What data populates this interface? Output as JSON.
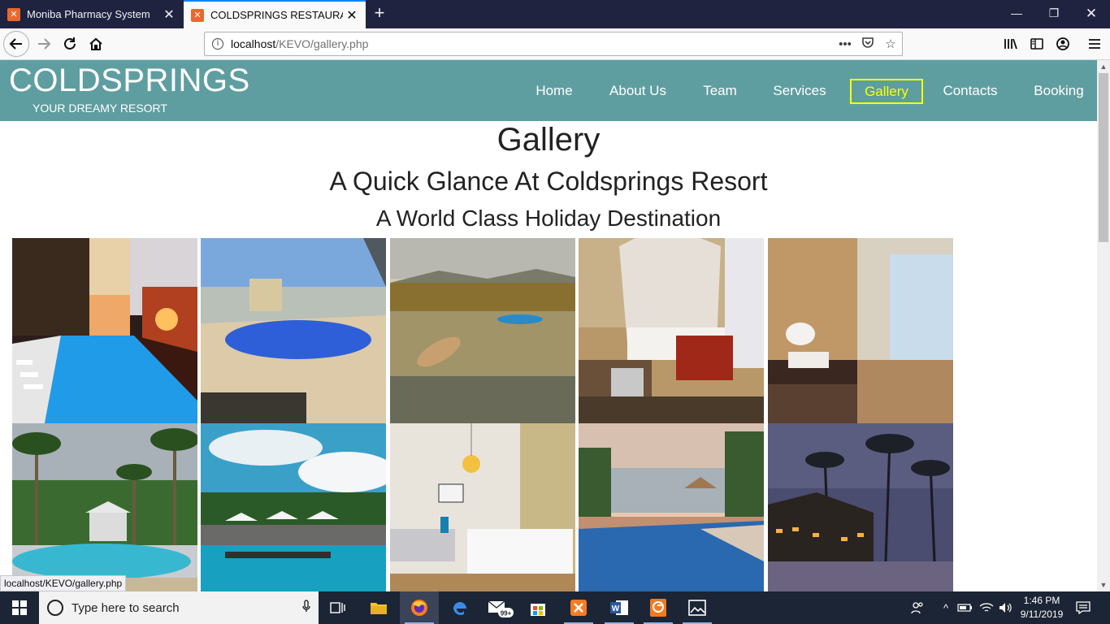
{
  "browser": {
    "tabs": [
      {
        "label": "Moniba Pharmacy System",
        "active": false
      },
      {
        "label": "COLDSPRINGS RESTAURANT",
        "active": true
      }
    ],
    "url_host": "localhost",
    "url_path": "/KEVO/gallery.php",
    "status_url": "localhost/KEVO/gallery.php"
  },
  "site": {
    "brand": "COLDSPRINGS",
    "tagline": "YOUR DREAMY RESORT",
    "menu": [
      "Home",
      "About Us",
      "Team",
      "Services",
      "Gallery",
      "Contacts",
      "Booking"
    ],
    "active_menu": "Gallery",
    "header_color": "#5f9ea0",
    "active_color": "#ffff00"
  },
  "content": {
    "heading": "Gallery",
    "subheading": "A Quick Glance At Coldsprings Resort",
    "tagline2": "A World Class Holiday Destination",
    "photos": [
      {
        "subject": "city hotel infinity pool at dusk"
      },
      {
        "subject": "rooftop swimming pool with loungers"
      },
      {
        "subject": "rowing boats on calm lake with reeds"
      },
      {
        "subject": "canopy bed hotel room"
      },
      {
        "subject": "hotel bathroom with glass shower"
      },
      {
        "subject": "tropical pool with palm trees and gazebo"
      },
      {
        "subject": "pool with white umbrellas under blue sky"
      },
      {
        "subject": "modern bedroom with pendant lamp"
      },
      {
        "subject": "infinity pool overlooking lake"
      },
      {
        "subject": "resort with palm trees at night"
      }
    ]
  },
  "taskbar": {
    "search_placeholder": "Type here to search",
    "mail_badge": "99+",
    "time": "1:46 PM",
    "date": "9/11/2019"
  }
}
